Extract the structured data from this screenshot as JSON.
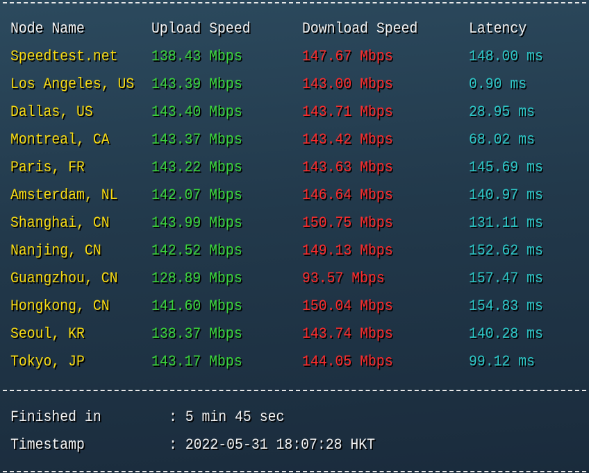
{
  "colors": {
    "header": "#f2f2f2",
    "node": "#f7da12",
    "upload": "#3bd63b",
    "download": "#ff2b2b",
    "latency": "#2ec8c8"
  },
  "headers": {
    "node": "Node Name",
    "upload": "Upload Speed",
    "download": "Download Speed",
    "latency": "Latency"
  },
  "rows": [
    {
      "node": "Speedtest.net",
      "upload": "138.43 Mbps",
      "download": "147.67 Mbps",
      "latency": "148.00 ms"
    },
    {
      "node": "Los Angeles, US",
      "upload": "143.39 Mbps",
      "download": "143.00 Mbps",
      "latency": "0.90 ms"
    },
    {
      "node": "Dallas, US",
      "upload": "143.40 Mbps",
      "download": "143.71 Mbps",
      "latency": "28.95 ms"
    },
    {
      "node": "Montreal, CA",
      "upload": "143.37 Mbps",
      "download": "143.42 Mbps",
      "latency": "68.02 ms"
    },
    {
      "node": "Paris, FR",
      "upload": "143.22 Mbps",
      "download": "143.63 Mbps",
      "latency": "145.69 ms"
    },
    {
      "node": "Amsterdam, NL",
      "upload": "142.07 Mbps",
      "download": "146.64 Mbps",
      "latency": "140.97 ms"
    },
    {
      "node": "Shanghai, CN",
      "upload": "143.99 Mbps",
      "download": "150.75 Mbps",
      "latency": "131.11 ms"
    },
    {
      "node": "Nanjing, CN",
      "upload": "142.52 Mbps",
      "download": "149.13 Mbps",
      "latency": "152.62 ms"
    },
    {
      "node": "Guangzhou, CN",
      "upload": "128.89 Mbps",
      "download": "93.57 Mbps",
      "latency": "157.47 ms"
    },
    {
      "node": "Hongkong, CN",
      "upload": "141.60 Mbps",
      "download": "150.04 Mbps",
      "latency": "154.83 ms"
    },
    {
      "node": "Seoul, KR",
      "upload": "138.37 Mbps",
      "download": "143.74 Mbps",
      "latency": "140.28 ms"
    },
    {
      "node": "Tokyo, JP",
      "upload": "143.17 Mbps",
      "download": "144.05 Mbps",
      "latency": "99.12 ms"
    }
  ],
  "summary": [
    {
      "label": "Finished in",
      "value": ": 5 min 45 sec"
    },
    {
      "label": "Timestamp",
      "value": ": 2022-05-31 18:07:28 HKT"
    }
  ]
}
